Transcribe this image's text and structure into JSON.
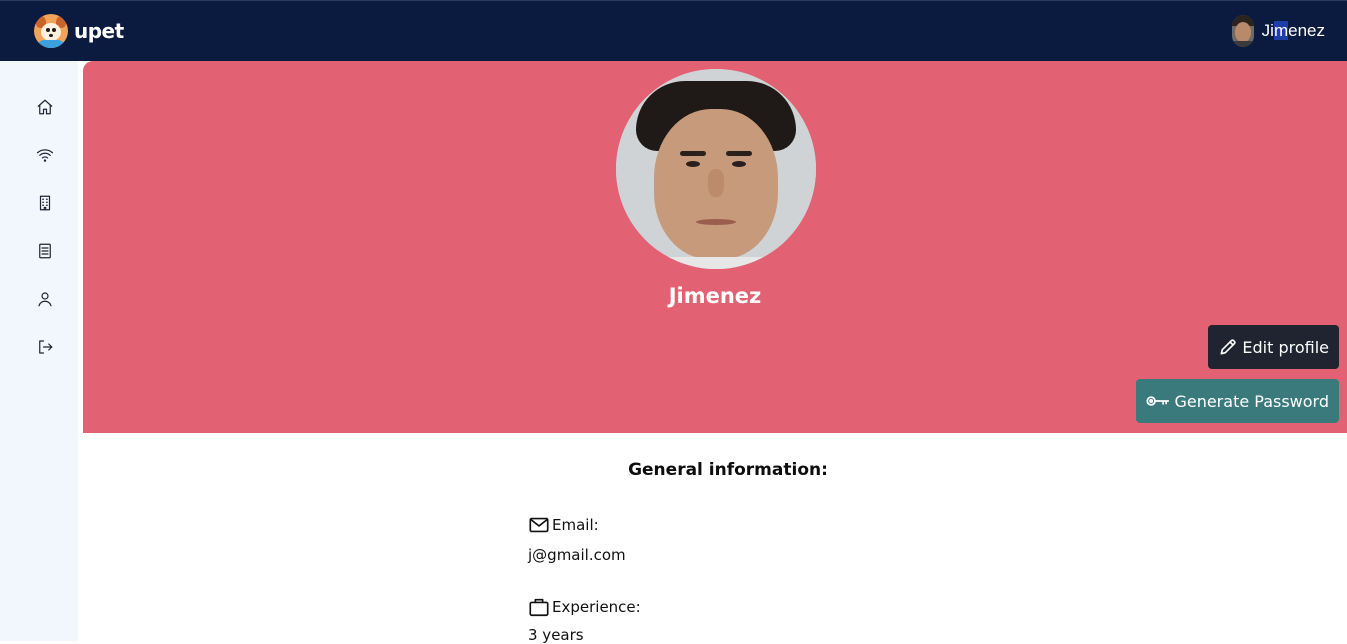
{
  "header": {
    "brand": "upet",
    "user_name_pre": "Ji",
    "user_name_sel": "m",
    "user_name_post": "enez"
  },
  "sidebar": {
    "items": [
      {
        "icon": "home-icon"
      },
      {
        "icon": "wifi-icon"
      },
      {
        "icon": "building-icon"
      },
      {
        "icon": "notebook-icon"
      },
      {
        "icon": "user-icon"
      },
      {
        "icon": "logout-icon"
      }
    ]
  },
  "profile": {
    "name": "Jimenez",
    "edit_label": "Edit profile",
    "generate_label": "Generate Password"
  },
  "info": {
    "title": "General information:",
    "email_label": "Email:",
    "email_value": "j@gmail.com",
    "experience_label": "Experience:",
    "experience_value": "3 years"
  },
  "colors": {
    "topbar": "#0b1a3f",
    "hero": "#e26273",
    "edit_button": "#1f2430",
    "generate_button": "#3a7a7c",
    "sidebar": "#f2f6fd"
  }
}
